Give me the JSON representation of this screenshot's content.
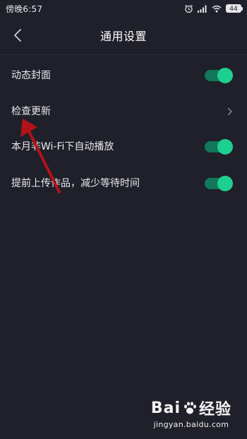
{
  "status_bar": {
    "time": "傍晚6:57",
    "battery": "44"
  },
  "header": {
    "title": "通用设置"
  },
  "settings": [
    {
      "label": "动态封面",
      "control": "toggle",
      "on": true
    },
    {
      "label": "检查更新",
      "control": "chevron"
    },
    {
      "label": "本月非Wi-Fi下自动播放",
      "control": "toggle",
      "on": true
    },
    {
      "label": "提前上传作品，减少等待时间",
      "control": "toggle",
      "on": true
    }
  ],
  "colors": {
    "background": "#1f2029",
    "toggle_on": "#1ed08f",
    "arrow": "#b3121a"
  },
  "watermark": {
    "brand_a": "Bai",
    "brand_b": "经验",
    "url": "jingyan.baidu.com"
  }
}
